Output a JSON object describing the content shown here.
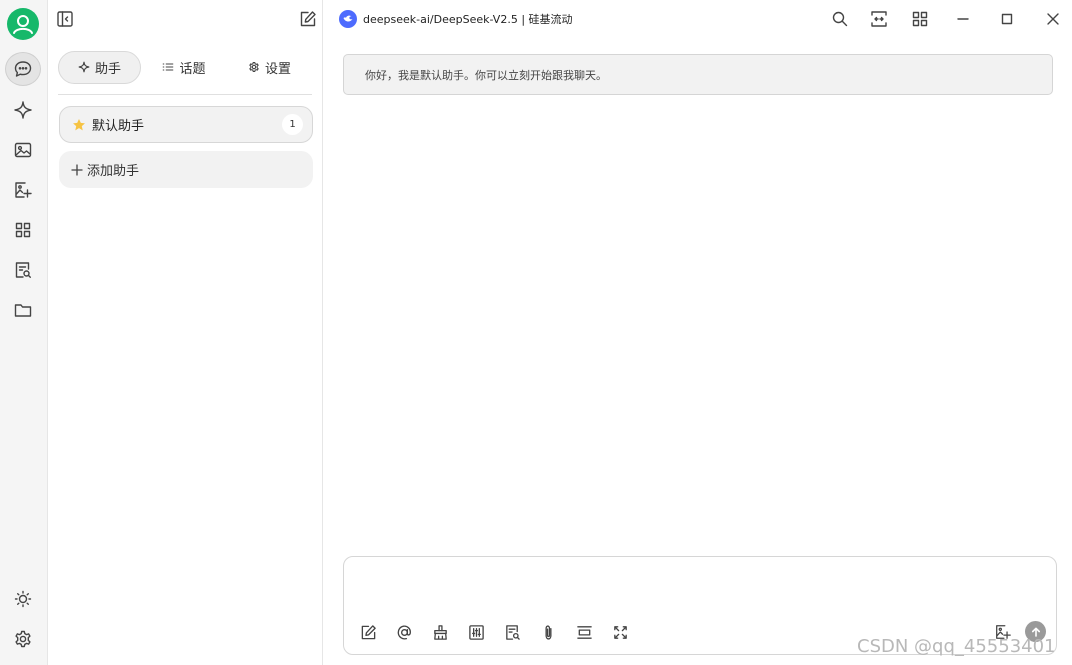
{
  "sidebar": {
    "items": [
      {
        "icon": "chat-bubble-icon",
        "active": true
      },
      {
        "icon": "sparkle-icon"
      },
      {
        "icon": "image-icon"
      },
      {
        "icon": "image-edit-icon"
      },
      {
        "icon": "apps-grid-icon"
      },
      {
        "icon": "document-search-icon"
      },
      {
        "icon": "folder-icon"
      }
    ],
    "bottom": [
      {
        "icon": "sun-icon"
      },
      {
        "icon": "settings-gear-icon"
      }
    ]
  },
  "panel": {
    "tabs": [
      {
        "label": "助手",
        "icon": "sparkle-icon",
        "active": true
      },
      {
        "label": "话题",
        "icon": "list-icon"
      },
      {
        "label": "设置",
        "icon": "gear-icon"
      }
    ],
    "assistant": {
      "name": "默认助手",
      "count": "1",
      "icon": "star-icon"
    },
    "add_label": "添加助手"
  },
  "header": {
    "model_title": "deepseek-ai/DeepSeek-V2.5 | 硅基流动",
    "model_logo": "deepseek-whale-icon"
  },
  "chat": {
    "greeting": "你好，我是默认助手。你可以立刻开始跟我聊天。"
  },
  "composer": {
    "tools": [
      "new-topic-icon",
      "mention-icon",
      "clear-context-icon",
      "settings-sliders-icon",
      "web-search-icon",
      "attachment-icon",
      "expand-context-icon",
      "fullscreen-icon"
    ]
  },
  "watermark": "CSDN @qq_45553401",
  "colors": {
    "avatar": "#16b86a",
    "model_logo": "#4d6bfe",
    "star": "#f6c343",
    "send": "#9a9a9a"
  }
}
